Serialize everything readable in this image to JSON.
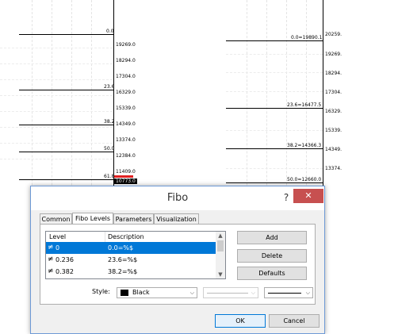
{
  "left_chart": {
    "fibo_labels": [
      "0.0",
      "23.6",
      "38.2",
      "50.0",
      "61.8"
    ],
    "tick_labels": [
      "19269.0",
      "18294.0",
      "17304.0",
      "16329.0",
      "15339.0",
      "14349.0",
      "13374.0",
      "12384.0",
      "11409.0"
    ],
    "price_badge": "10773.0"
  },
  "right_chart": {
    "fibo_labels": [
      "0.0=19890.1",
      "23.6=16477.5",
      "38.2=14366.3",
      "50.0=12660.0"
    ],
    "tick_labels": [
      "20259.",
      "19269.",
      "18294.",
      "17304.",
      "16329.",
      "15339.",
      "14349.",
      "13374."
    ]
  },
  "dialog": {
    "title": "Fibo",
    "help": "?",
    "close": "✕",
    "tabs": [
      "Common",
      "Fibo Levels",
      "Parameters",
      "Visualization"
    ],
    "table": {
      "headers": {
        "level": "Level",
        "description": "Description"
      },
      "rows": [
        {
          "level": "0",
          "description": "0.0=%$",
          "icon": "≠"
        },
        {
          "level": "0.236",
          "description": "23.6=%$",
          "icon": "≠"
        },
        {
          "level": "0.382",
          "description": "38.2=%$",
          "icon": "≠"
        }
      ]
    },
    "buttons": {
      "add": "Add",
      "delete": "Delete",
      "defaults": "Defaults",
      "ok": "OK",
      "cancel": "Cancel"
    },
    "style": {
      "label": "Style:",
      "color_name": "Black",
      "color_hex": "#000000"
    }
  }
}
